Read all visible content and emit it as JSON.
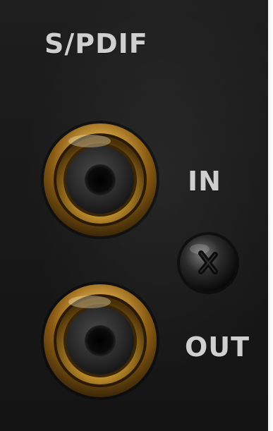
{
  "panel": {
    "title": "S/PDIF",
    "ports": [
      {
        "label": "IN"
      },
      {
        "label": "OUT"
      }
    ]
  },
  "colors": {
    "panel_background": "#1b1b1b",
    "label_text": "#cfcfcf",
    "gold": "#c9962f",
    "jack_insulator": "#2b2b2b"
  },
  "icons": [
    "rca-jack-icon",
    "screw-icon"
  ]
}
